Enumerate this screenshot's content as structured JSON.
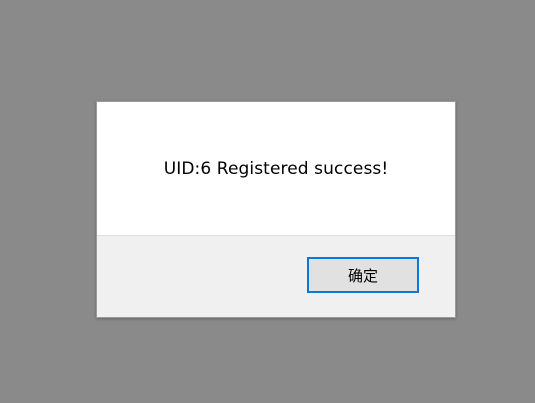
{
  "dialog": {
    "message": "UID:6 Registered success!",
    "ok_label": "确定"
  },
  "colors": {
    "backdrop": "#8a8a8a",
    "dialog_body": "#ffffff",
    "dialog_footer": "#f0f0f0",
    "button_border_focus": "#0a78d7",
    "button_face": "#e1e1e1"
  }
}
